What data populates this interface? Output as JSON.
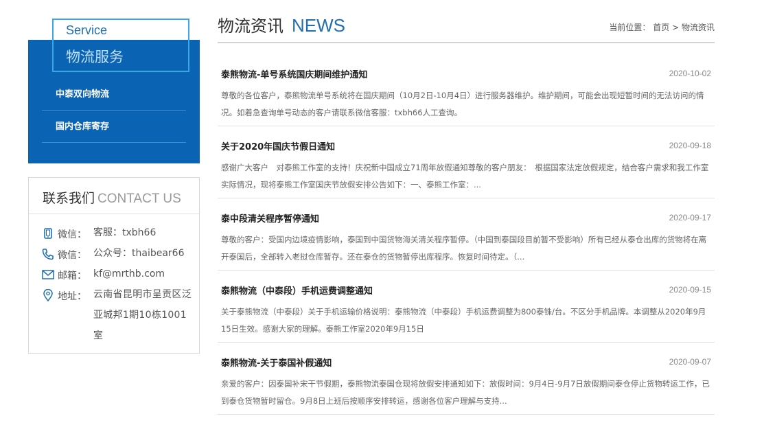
{
  "service": {
    "title_en": "Service",
    "title_cn": "物流服务",
    "items": [
      {
        "label": "中泰双向物流"
      },
      {
        "label": "国内仓库寄存"
      }
    ]
  },
  "contact": {
    "title_cn": "联系我们",
    "title_en": "CONTACT US",
    "rows": [
      {
        "icon": "phone-icon",
        "label": "微信：",
        "value": "客服：txbh66"
      },
      {
        "icon": "handset-icon",
        "label": "微信：",
        "value": "公众号：thaibear66"
      },
      {
        "icon": "mail-icon",
        "label": "邮箱：",
        "value": "kf@mrthb.com"
      },
      {
        "icon": "location-pin-icon",
        "label": "地址：",
        "value": "云南省昆明市呈贡区泛亚城邦1期10栋1001室"
      }
    ]
  },
  "main": {
    "title_cn": "物流资讯",
    "title_en": "NEWS",
    "breadcrumb": {
      "prefix": "当前位置：",
      "home": "首页",
      "separator": ">",
      "current": "物流资讯"
    }
  },
  "news": [
    {
      "title": "泰熊物流-单号系统国庆期间维护通知",
      "date": "2020-10-02",
      "summary": "尊敬的各位客户，泰熊物流单号系统将在国庆期间（10月2日-10月4日）进行服务器维护。维护期间，可能会出现短暂时间的无法访问的情况。如着急查询单号动态的客户请联系微信客服：txbh66人工查询。"
    },
    {
      "title": "关于2020年国庆节假日通知",
      "date": "2020-09-18",
      "summary": "感谢广大客户　对泰熊工作室的支持！庆祝新中国成立71周年放假通知尊敬的客户朋友：　根据国家法定放假规定，结合客户需求和我工作室实际情况，现将泰熊工作室国庆节放假安排公告如下：一、泰熊工作室：..."
    },
    {
      "title": "泰中段清关程序暂停通知",
      "date": "2020-09-17",
      "summary": "尊敬的客户：受国内边境疫情影响，泰国到中国货物海关清关程序暂停。（中国到泰国段目前暂不受影响）所有已经从泰仓出库的货物将在离开泰国后，全部转入老挝仓库暂存。还在泰仓的货物暂停出库程序。恢复时间待定。（..."
    },
    {
      "title": "泰熊物流（中泰段）手机运费调整通知",
      "date": "2020-09-15",
      "summary": "关于泰熊物流（中泰段）关于手机运输价格说明：泰熊物流（中泰段）手机运费调整为800泰铢/台。不区分手机品牌。本调整从2020年9月15日生效。感谢大家的理解。泰熊工作室2020年9月15日"
    },
    {
      "title": "泰熊物流-关于泰国补假通知",
      "date": "2020-09-07",
      "summary": "亲爱的客户：因泰国补宋干节假期，泰熊物流泰国仓现将放假安排通知如下：放假时间：9月4日-9月7日放假期间泰仓停止货物转运工作，已到泰仓货物暂时留仓。9月8日上班后按顺序安排转运，感谢各位客户理解与支持..."
    }
  ]
}
